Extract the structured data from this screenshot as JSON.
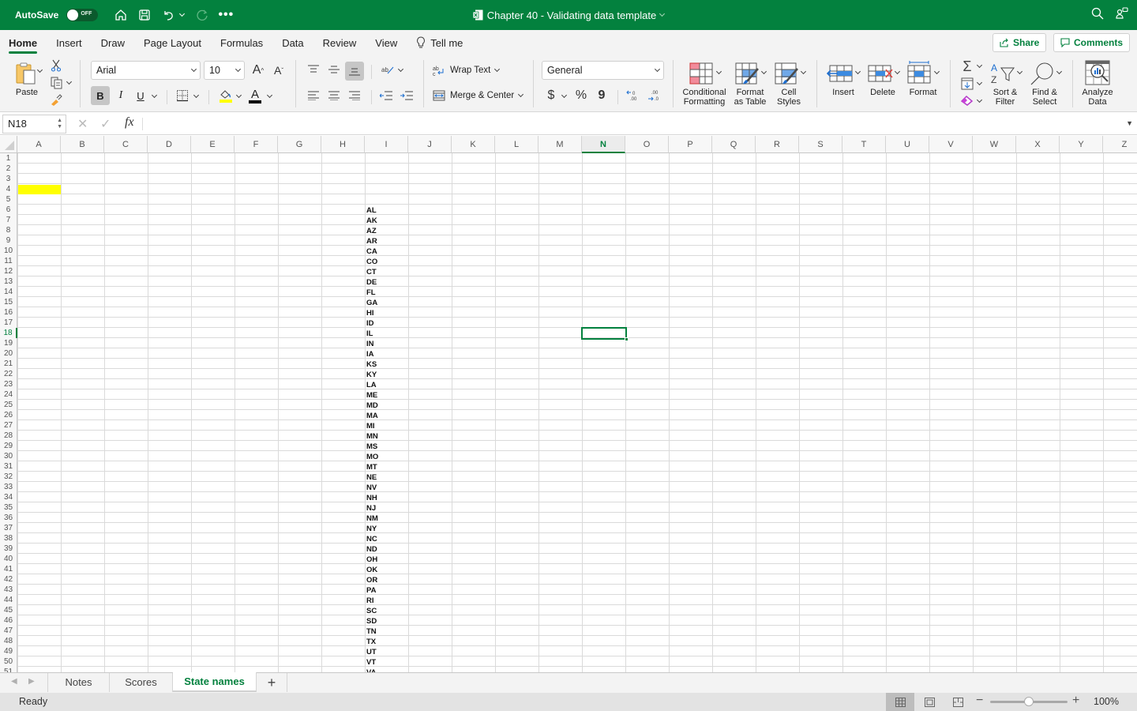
{
  "titlebar": {
    "autosave_label": "AutoSave",
    "autosave_state": "OFF",
    "document_title": "Chapter 40 - Validating data template",
    "icons": [
      "home-icon",
      "save-icon",
      "undo-icon",
      "redo-icon",
      "more-icon",
      "search-icon",
      "share-person-icon"
    ]
  },
  "menu_tabs": [
    {
      "label": "Home",
      "active": true
    },
    {
      "label": "Insert"
    },
    {
      "label": "Draw"
    },
    {
      "label": "Page Layout"
    },
    {
      "label": "Formulas"
    },
    {
      "label": "Data"
    },
    {
      "label": "Review"
    },
    {
      "label": "View"
    },
    {
      "label": "Tell me",
      "icon": "lightbulb-icon"
    }
  ],
  "actions": {
    "share": "Share",
    "comments": "Comments"
  },
  "ribbon": {
    "paste": "Paste",
    "font_name": "Arial",
    "font_size": "10",
    "wrap_text": "Wrap Text",
    "merge_center": "Merge & Center",
    "number_format": "General",
    "currency": "$",
    "percent": "%",
    "comma": "9",
    "conditional_formatting": [
      "Conditional",
      "Formatting"
    ],
    "format_as_table": [
      "Format",
      "as Table"
    ],
    "cell_styles": [
      "Cell",
      "Styles"
    ],
    "insert": "Insert",
    "delete": "Delete",
    "format": "Format",
    "sort_filter": [
      "Sort &",
      "Filter"
    ],
    "find_select": [
      "Find &",
      "Select"
    ],
    "analyze_data": [
      "Analyze",
      "Data"
    ],
    "bold": "B",
    "italic": "I",
    "underline": "U",
    "fill_color": "#ffff00",
    "font_color": "#000000"
  },
  "formula_bar": {
    "name_box": "N18",
    "fx": "fx",
    "formula": ""
  },
  "grid": {
    "columns": [
      "A",
      "B",
      "C",
      "D",
      "E",
      "F",
      "G",
      "H",
      "I",
      "J",
      "K",
      "L",
      "M",
      "N",
      "O",
      "P",
      "Q",
      "R",
      "S",
      "T",
      "U",
      "V",
      "W",
      "X",
      "Y",
      "Z"
    ],
    "selected_column": "N",
    "selected_row": 18,
    "selected_cell": "N18",
    "first_row": 1,
    "last_row": 51,
    "highlighted_cell": {
      "ref": "A4",
      "color": "#ffff00"
    },
    "state_column": "I",
    "state_start_row": 6,
    "states": [
      "AL",
      "AK",
      "AZ",
      "AR",
      "CA",
      "CO",
      "CT",
      "DE",
      "FL",
      "GA",
      "HI",
      "ID",
      "IL",
      "IN",
      "IA",
      "KS",
      "KY",
      "LA",
      "ME",
      "MD",
      "MA",
      "MI",
      "MN",
      "MS",
      "MO",
      "MT",
      "NE",
      "NV",
      "NH",
      "NJ",
      "NM",
      "NY",
      "NC",
      "ND",
      "OH",
      "OK",
      "OR",
      "PA",
      "RI",
      "SC",
      "SD",
      "TN",
      "TX",
      "UT",
      "VT",
      "VA"
    ]
  },
  "sheets": [
    {
      "label": "Notes"
    },
    {
      "label": "Scores"
    },
    {
      "label": "State names",
      "active": true
    }
  ],
  "add_sheet": "+",
  "status": {
    "text": "Ready",
    "zoom": "100%",
    "zoom_level_percent": 100
  },
  "colors": {
    "accent": "#03813e"
  }
}
